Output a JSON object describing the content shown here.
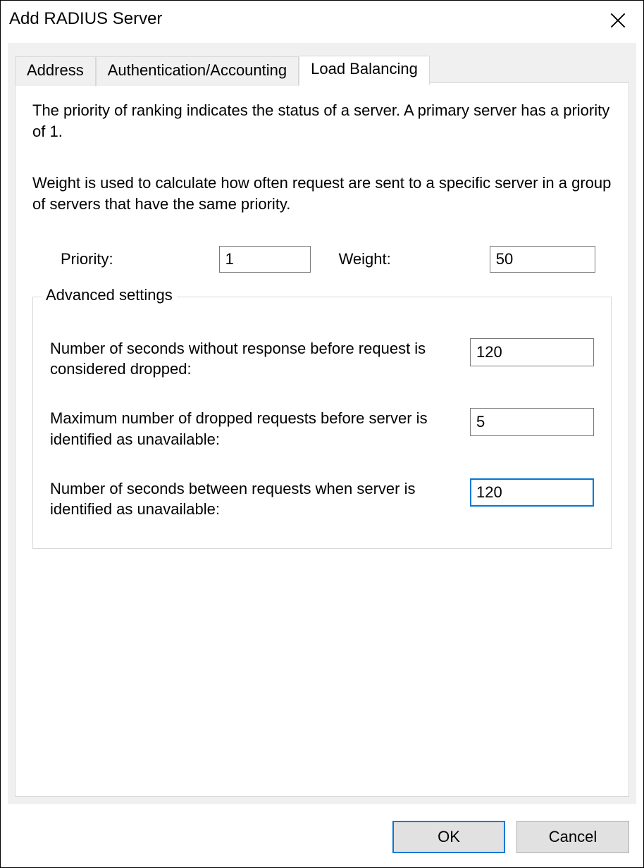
{
  "dialog": {
    "title": "Add RADIUS Server"
  },
  "tabs": [
    {
      "label": "Address"
    },
    {
      "label": "Authentication/Accounting"
    },
    {
      "label": "Load Balancing"
    }
  ],
  "active_tab_index": 2,
  "load_balancing": {
    "priority_description": "The priority of ranking indicates the status of a server. A primary server has a priority of 1.",
    "weight_description": "Weight is used to calculate how often request are sent to a specific server in a group of servers that have the same priority.",
    "priority_label": "Priority:",
    "priority_value": "1",
    "weight_label": "Weight:",
    "weight_value": "50",
    "advanced_legend": "Advanced settings",
    "adv_dropped_seconds_label": "Number of seconds without response before request is considered dropped:",
    "adv_dropped_seconds_value": "120",
    "adv_max_dropped_label": "Maximum number of dropped requests before server is identified as unavailable:",
    "adv_max_dropped_value": "5",
    "adv_retry_seconds_label": "Number of seconds between requests when server is identified as unavailable:",
    "adv_retry_seconds_value": "120"
  },
  "buttons": {
    "ok": "OK",
    "cancel": "Cancel"
  }
}
